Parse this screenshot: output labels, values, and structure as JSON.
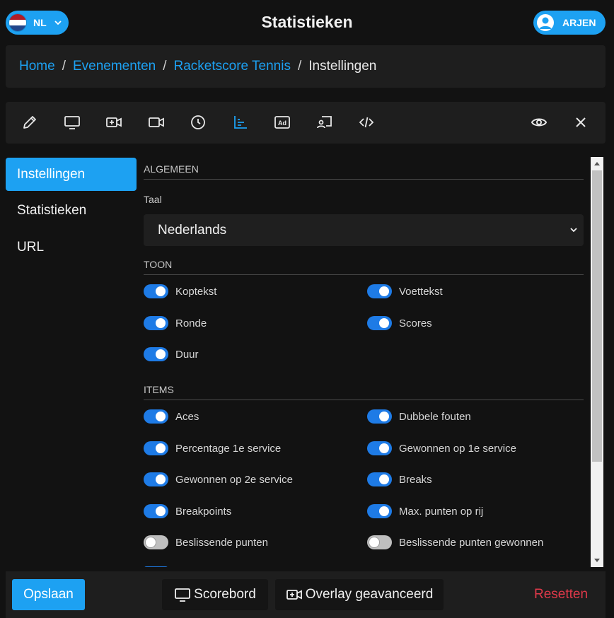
{
  "header": {
    "language": {
      "code": "NL",
      "flag_colors": [
        "#ae1c28",
        "#ffffff",
        "#21468b"
      ]
    },
    "title": "Statistieken",
    "user": {
      "name": "ARJEN"
    }
  },
  "breadcrumb": {
    "items": [
      "Home",
      "Evenementen",
      "Racketscore Tennis"
    ],
    "separator": "/",
    "current": "Instellingen"
  },
  "toolbar": {
    "tools": [
      "pencil-icon",
      "monitor-icon",
      "video-plus-icon",
      "video-icon",
      "clock-icon",
      "chart-icon",
      "ad-icon",
      "cast-icon",
      "code-icon"
    ],
    "active_tool": "chart-icon",
    "right_tools": [
      "eye-icon",
      "close-icon"
    ]
  },
  "sidebar": {
    "items": [
      {
        "label": "Instellingen",
        "active": true
      },
      {
        "label": "Statistieken",
        "active": false
      },
      {
        "label": "URL",
        "active": false
      }
    ]
  },
  "settings": {
    "general": {
      "heading": "ALGEMEEN",
      "language_label": "Taal",
      "language_value": "Nederlands"
    },
    "show": {
      "heading": "TOON",
      "toggles": [
        {
          "label": "Koptekst",
          "on": true
        },
        {
          "label": "Voettekst",
          "on": true
        },
        {
          "label": "Ronde",
          "on": true
        },
        {
          "label": "Scores",
          "on": true
        },
        {
          "label": "Duur",
          "on": true
        }
      ]
    },
    "items": {
      "heading": "ITEMS",
      "toggles": [
        {
          "label": "Aces",
          "on": true
        },
        {
          "label": "Dubbele fouten",
          "on": true
        },
        {
          "label": "Percentage 1e service",
          "on": true
        },
        {
          "label": "Gewonnen op 1e service",
          "on": true
        },
        {
          "label": "Gewonnen op 2e service",
          "on": true
        },
        {
          "label": "Breaks",
          "on": true
        },
        {
          "label": "Breakpoints",
          "on": true
        },
        {
          "label": "Max. punten op rij",
          "on": true
        },
        {
          "label": "Beslissende punten",
          "on": false
        },
        {
          "label": "Beslissende punten gewonnen",
          "on": false
        }
      ]
    }
  },
  "footer": {
    "save_label": "Opslaan",
    "scoreboard_label": "Scorebord",
    "overlay_label": "Overlay geavanceerd",
    "reset_label": "Resetten"
  },
  "colors": {
    "accent": "#1da1f2",
    "toggle_on": "#1e7be6",
    "danger": "#e0394a",
    "background": "#121212",
    "surface": "#1e1e1e"
  }
}
